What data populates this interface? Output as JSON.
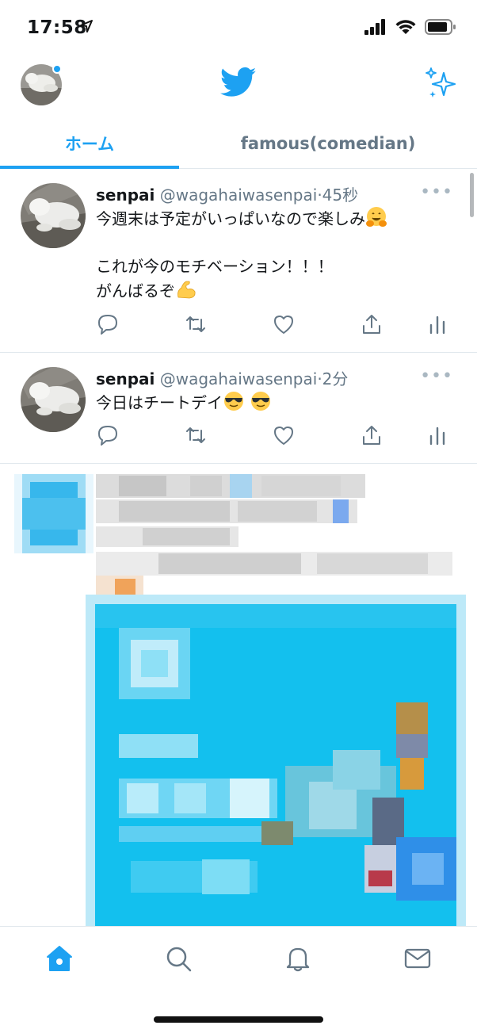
{
  "status_bar": {
    "time": "17:58",
    "location_icon": "location-arrow-icon",
    "icons": [
      "cellular-signal-icon",
      "wifi-icon",
      "battery-icon"
    ]
  },
  "header": {
    "avatar_icon": "profile-avatar",
    "logo_icon": "twitter-bird-icon",
    "sparkle_icon": "sparkle-icon"
  },
  "tabs": [
    {
      "label": "ホーム",
      "active": true
    },
    {
      "label": "famous(comedian)",
      "active": false
    }
  ],
  "tweets": [
    {
      "name": "senpai",
      "handle": "@wagahaiwasenpai",
      "time": "45秒",
      "separator": "·",
      "more": "•••",
      "lines": [
        "今週末は予定がいっぱいなので楽しみ",
        "",
        "これが今のモチベーション！！！",
        "がんばるぞ"
      ],
      "emojis": [
        "hugging-face-emoji",
        "flexed-biceps-emoji"
      ]
    },
    {
      "name": "senpai",
      "handle": "@wagahaiwasenpai",
      "time": "2分",
      "separator": "·",
      "more": "•••",
      "lines": [
        "今日はチートデイ"
      ],
      "emojis": [
        "sunglasses-emoji",
        "sunglasses-emoji"
      ]
    }
  ],
  "actions": [
    "reply-icon",
    "retweet-icon",
    "like-icon",
    "share-icon",
    "analytics-icon"
  ],
  "bottom_nav": [
    {
      "name": "home",
      "icon": "home-icon",
      "active": true
    },
    {
      "name": "search",
      "icon": "search-icon",
      "active": false
    },
    {
      "name": "notifications",
      "icon": "bell-icon",
      "active": false
    },
    {
      "name": "messages",
      "icon": "mail-icon",
      "active": false
    }
  ],
  "colors": {
    "accent": "#1da1f2",
    "text": "#14171a",
    "secondary": "#657786",
    "divider": "#e1e8ed"
  }
}
